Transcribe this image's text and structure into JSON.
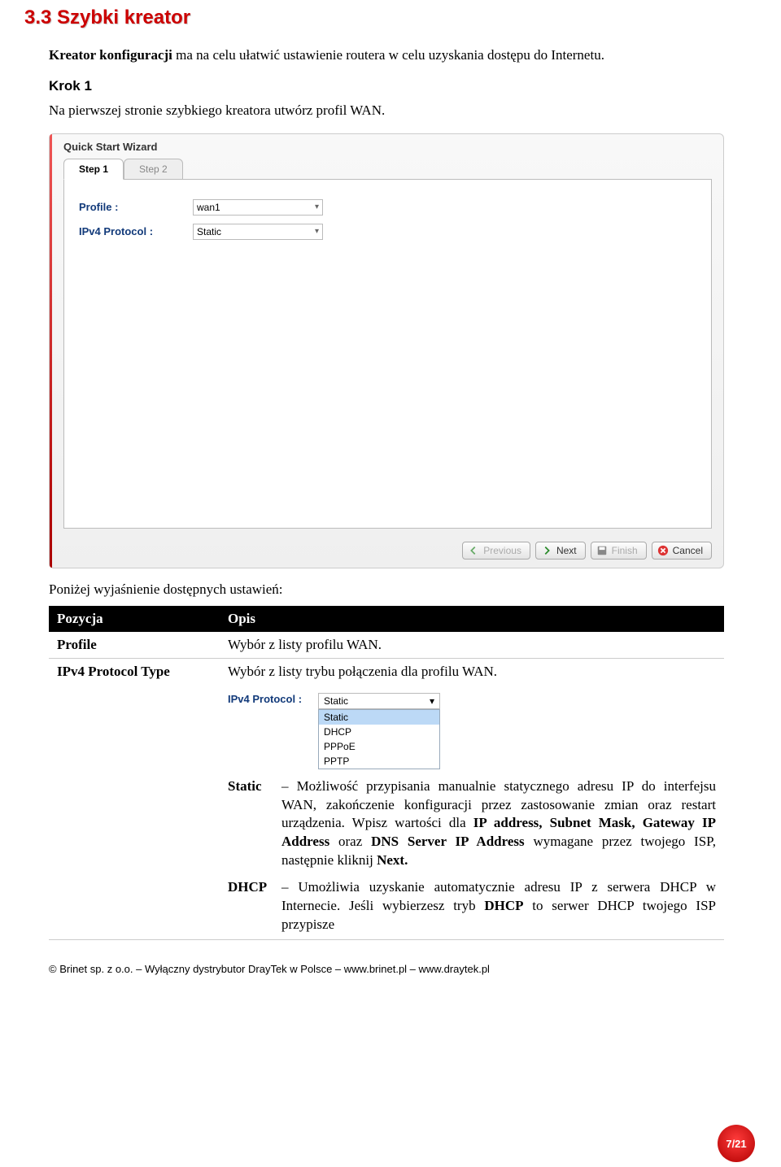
{
  "heading": "3.3 Szybki kreator",
  "intro_bold": "Kreator konfiguracji",
  "intro_rest": " ma na celu ułatwić ustawienie routera w celu uzyskania dostępu do Internetu.",
  "step_label": "Krok 1",
  "step_text": "Na pierwszej stronie szybkiego kreatora utwórz profil WAN.",
  "wizard": {
    "title": "Quick Start Wizard",
    "tabs": [
      "Step 1",
      "Step 2"
    ],
    "rows": [
      {
        "label": "Profile  :",
        "value": "wan1"
      },
      {
        "label": "IPv4 Protocol  :",
        "value": "Static"
      }
    ],
    "buttons": {
      "previous": "Previous",
      "next": "Next",
      "finish": "Finish",
      "cancel": "Cancel"
    }
  },
  "below": "Poniżej wyjaśnienie dostępnych ustawień:",
  "table": {
    "headers": [
      "Pozycja",
      "Opis"
    ],
    "rows": [
      {
        "item": "Profile",
        "desc": "Wybór z listy profilu WAN."
      }
    ],
    "protocol": {
      "item": "IPv4 Protocol Type",
      "desc_top": "Wybór z listy trybu połączenia dla profilu WAN.",
      "dropdown_label": "IPv4 Protocol  :",
      "dropdown_value": "Static",
      "options": [
        "Static",
        "DHCP",
        "PPPoE",
        "PPTP"
      ],
      "static_term": "Static",
      "static_sep": "–",
      "static_desc_parts": [
        "Możliwość przypisania manualnie statycznego adresu IP do interfejsu WAN, zakończenie konfiguracji przez zastosowanie zmian oraz restart urządzenia. Wpisz wartości dla ",
        "IP address, Subnet Mask, Gateway IP Address",
        " oraz ",
        "DNS Server IP Address",
        " wymagane przez twojego ISP, następnie kliknij ",
        "Next.",
        ""
      ],
      "dhcp_term": "DHCP",
      "dhcp_sep": "–",
      "dhcp_desc_parts": [
        "Umożliwia uzyskanie automatycznie adresu IP z serwera DHCP w Internecie. Jeśli wybierzesz tryb ",
        "DHCP",
        " to serwer DHCP twojego ISP przypisze"
      ]
    }
  },
  "footer": "© Brinet sp. z o.o. – Wyłączny dystrybutor DrayTek w Polsce – www.brinet.pl – www.draytek.pl",
  "page_number": "7/21"
}
